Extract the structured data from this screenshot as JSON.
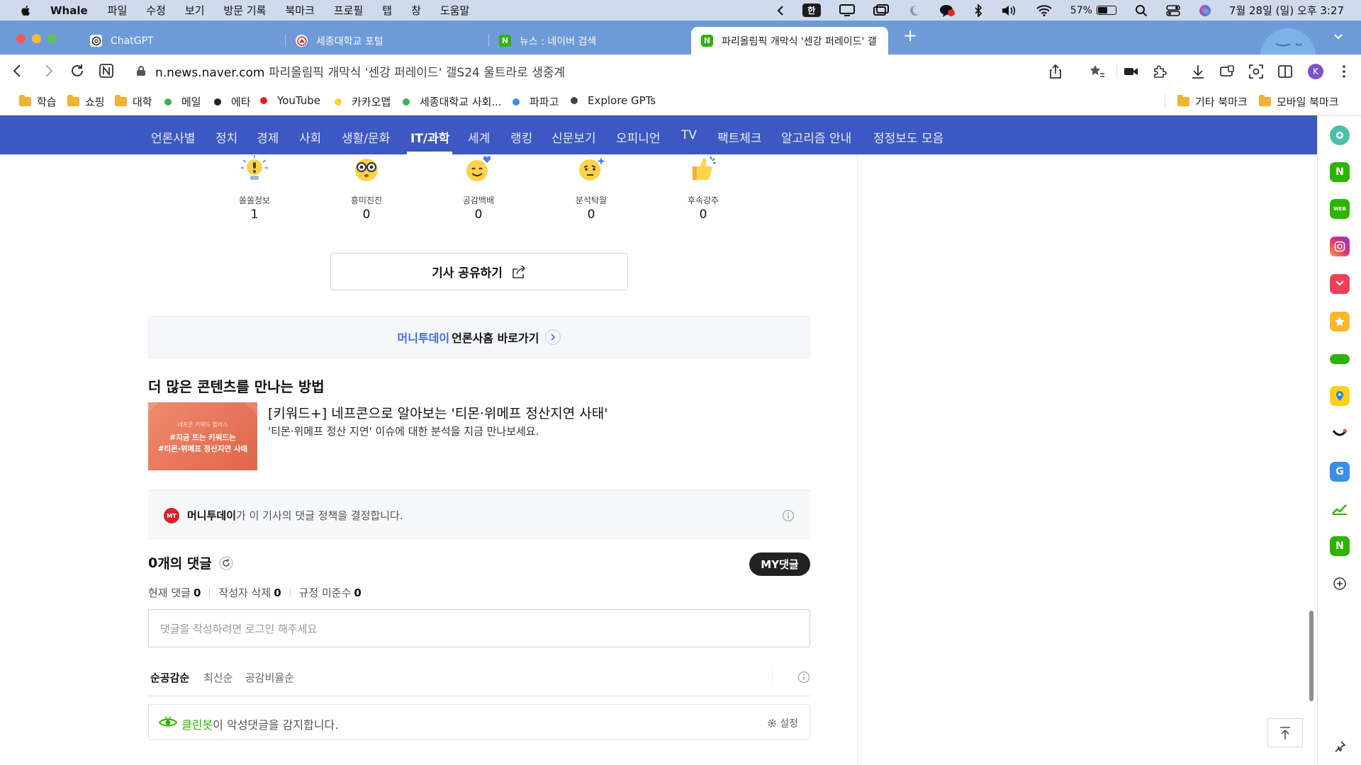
{
  "menubar": {
    "app_name": "Whale",
    "menus": [
      "파일",
      "수정",
      "보기",
      "방문 기록",
      "북마크",
      "프로필",
      "탭",
      "창",
      "도움말"
    ],
    "input_source": "한",
    "battery_percent": "57%",
    "battery_level": 0.57,
    "clock": "7월 28일 (일) 오후 3:27"
  },
  "tabs": [
    {
      "label": "ChatGPT",
      "icon": "chatgpt-icon",
      "active": false
    },
    {
      "label": "세종대학교 포털",
      "icon": "sejong-icon",
      "active": false
    },
    {
      "label": "뉴스 : 네이버 검색",
      "icon": "naver-icon",
      "active": false
    },
    {
      "label": "파리올림픽 개막식 '센강 퍼레이드' 갤",
      "icon": "naver-icon",
      "active": true
    }
  ],
  "address": {
    "host": "n.news.naver.com",
    "page_title": "파리올림픽 개막식 '센강 퍼레이드' 갤S24 울트라로 생중계",
    "profile_initial": "K"
  },
  "bookmarks": {
    "left": [
      {
        "label": "학습",
        "type": "folder"
      },
      {
        "label": "쇼핑",
        "type": "folder"
      },
      {
        "label": "대학",
        "type": "folder"
      },
      {
        "label": "메일",
        "type": "dot",
        "color": "#3ab54a"
      },
      {
        "label": "에타",
        "type": "dot",
        "color": "#222222"
      },
      {
        "label": "YouTube",
        "type": "dot",
        "color": "#e02020"
      },
      {
        "label": "카카오맵",
        "type": "dot",
        "color": "#f5d638"
      },
      {
        "label": "세종대학교 사회...",
        "type": "dot",
        "color": "#3ab54a"
      },
      {
        "label": "파파고",
        "type": "dot",
        "color": "#3a8ee8"
      },
      {
        "label": "Explore GPTs",
        "type": "dot",
        "color": "#444444"
      }
    ],
    "right": [
      {
        "label": "기타 북마크",
        "type": "folder"
      },
      {
        "label": "모바일 북마크",
        "type": "folder"
      }
    ]
  },
  "nav": {
    "items": [
      "언론사별",
      "정치",
      "경제",
      "사회",
      "생활/문화",
      "IT/과학",
      "세계",
      "랭킹",
      "신문보기",
      "오피니언",
      "TV",
      "팩트체크",
      "알고리즘 안내",
      "정정보도 모음"
    ],
    "active": "IT/과학"
  },
  "reactions": [
    {
      "label": "쏠쏠정보",
      "count": "1",
      "icon": "light-bulb-emoji-icon"
    },
    {
      "label": "흥미진진",
      "count": "0",
      "icon": "glasses-face-emoji-icon"
    },
    {
      "label": "공감백배",
      "count": "0",
      "icon": "smiling-heart-emoji-icon"
    },
    {
      "label": "분석탁월",
      "count": "0",
      "icon": "thinking-face-emoji-icon"
    },
    {
      "label": "후속강추",
      "count": "0",
      "icon": "thumbs-up-emoji-icon"
    }
  ],
  "share": {
    "label": "기사 공유하기"
  },
  "press_link": {
    "press": "머니투데이",
    "text": "언론사홈 바로가기"
  },
  "more_content": {
    "heading": "더 많은 콘텐츠를 만나는 방법",
    "thumb_small": "네프콘 키워드 플러스",
    "thumb_line1": "#지금 뜨는 키워드는",
    "thumb_line2": "#티몬·위메프 정산지연 사태",
    "title": "[키워드+] 네프콘으로 알아보는 '티몬·위메프 정산지연 사태'",
    "desc": "'티몬·위메프 정산 지연' 이슈에 대한 분석을 지금 만나보세요."
  },
  "policy": {
    "logo_text": "MT",
    "press": "머니투데이",
    "text": "가 이 기사의 댓글 정책을 결정합니다."
  },
  "comments": {
    "count": "0",
    "count_suffix": "개의 댓글",
    "my_button": "MY댓글",
    "stats": [
      {
        "label": "현재 댓글",
        "value": "0"
      },
      {
        "label": "작성자 삭제",
        "value": "0"
      },
      {
        "label": "규정 미준수",
        "value": "0"
      }
    ],
    "placeholder": "댓글을 작성하려면 로그인 해주세요",
    "sorts": [
      "순공감순",
      "최신순",
      "공감비율순"
    ],
    "cleanbot_name": "클린봇",
    "cleanbot_text": "이 악성댓글을 감지합니다.",
    "settings_label": "설정"
  },
  "sidebar_icons": [
    "whale-space-icon",
    "naver-icon",
    "webtoon-icon",
    "instagram-icon",
    "pocket-icon",
    "favorites-star-icon",
    "wallet-icon",
    "map-pin-icon",
    "smile-icon",
    "translate-icon",
    "stock-chart-icon",
    "naver-shopping-icon",
    "add-icon",
    "pin-icon"
  ]
}
